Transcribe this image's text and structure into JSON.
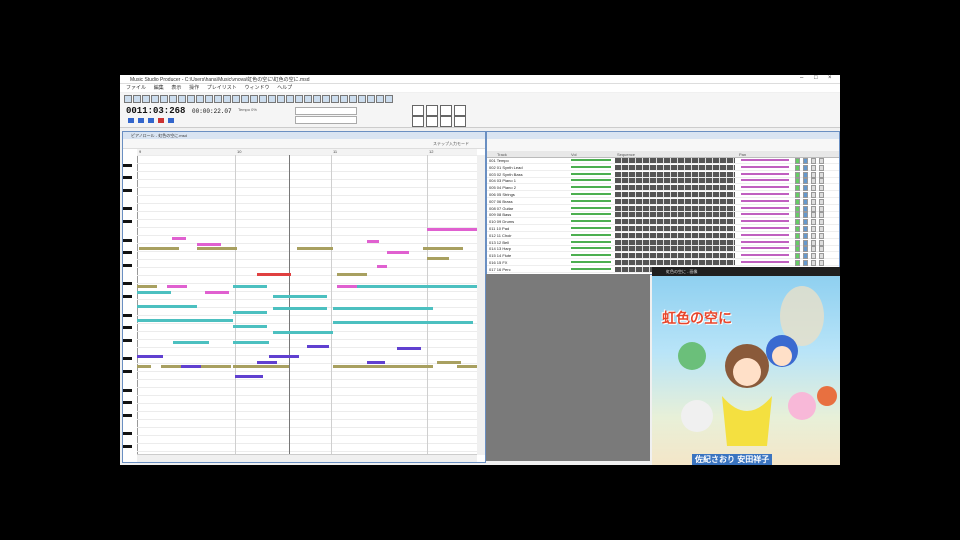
{
  "window": {
    "title": "Music Studio Producer - C:\\Users\\hana\\Music\\vnova\\虹色の空に\\虹色の空に.msd"
  },
  "menu": [
    "ファイル",
    "編集",
    "表示",
    "操作",
    "プレイリスト",
    "ウィンドウ",
    "ヘルプ"
  ],
  "transport": {
    "counter": "0011:03:268",
    "timecode": "00:00:22.07",
    "tempo_label": "Tempo 0%"
  },
  "piano_roll": {
    "title": "ピアノロール - 虹色の空に.msd",
    "ruler": [
      "9",
      "10",
      "11",
      "12"
    ],
    "mode_label": "ステップ入力モード"
  },
  "track_list": {
    "columns": [
      "Track",
      "Vol",
      "Sequence",
      "Pan"
    ],
    "tracks": [
      "001 Tempo",
      "002 01 Synth Lead",
      "003 02 Synth Bass",
      "004 03 Piano 1",
      "005 04 Piano 2",
      "006 05 Strings",
      "007 06 Brass",
      "008 07 Guitar",
      "009 08 Bass",
      "010 09 Drums",
      "011 10 Pad",
      "012 11 Choir",
      "013 12 Bell",
      "014 13 Harp",
      "015 14 Flute",
      "016 15 FX",
      "017 16 Perc"
    ]
  },
  "image_viewer": {
    "title": "虹色の空に - 画像"
  },
  "artwork": {
    "title": "虹色の空に",
    "credit": "佐紀さおり 安田祥子"
  },
  "colors": {
    "accent": "#3366cc",
    "teal": "#4cc0c0",
    "pink": "#e060d0",
    "red": "#e04040",
    "olive": "#a8a060",
    "purple": "#6040d0"
  }
}
